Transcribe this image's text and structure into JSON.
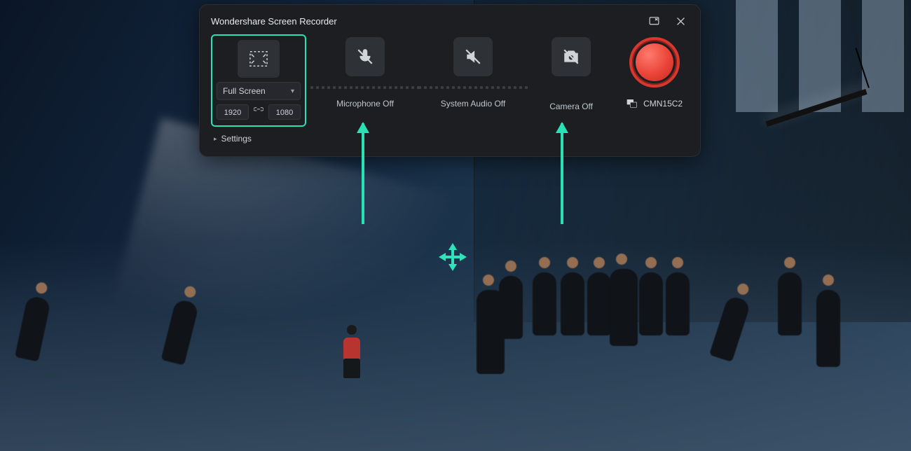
{
  "header": {
    "title": "Wondershare Screen Recorder"
  },
  "capture": {
    "mode_label": "Full Screen",
    "width": "1920",
    "height": "1080"
  },
  "options": {
    "microphone_label": "Microphone Off",
    "system_audio_label": "System Audio Off",
    "camera_label": "Camera Off"
  },
  "monitor": {
    "name": "CMN15C2"
  },
  "footer": {
    "settings_label": "Settings"
  },
  "icons": {
    "collapse": "collapse-icon",
    "close": "close-icon",
    "fullscreen": "fullscreen-select-icon",
    "lock": "link-lock-icon",
    "mic_off": "microphone-off-icon",
    "speaker_off": "speaker-off-icon",
    "camera_off": "camera-off-icon",
    "monitor": "monitor-icon",
    "move": "move-handle-icon"
  },
  "colors": {
    "accent_teal": "#28e2b6",
    "panel_bg": "#1c1e22",
    "tile_bg": "#2e3136",
    "record_red": "#eb4438"
  }
}
